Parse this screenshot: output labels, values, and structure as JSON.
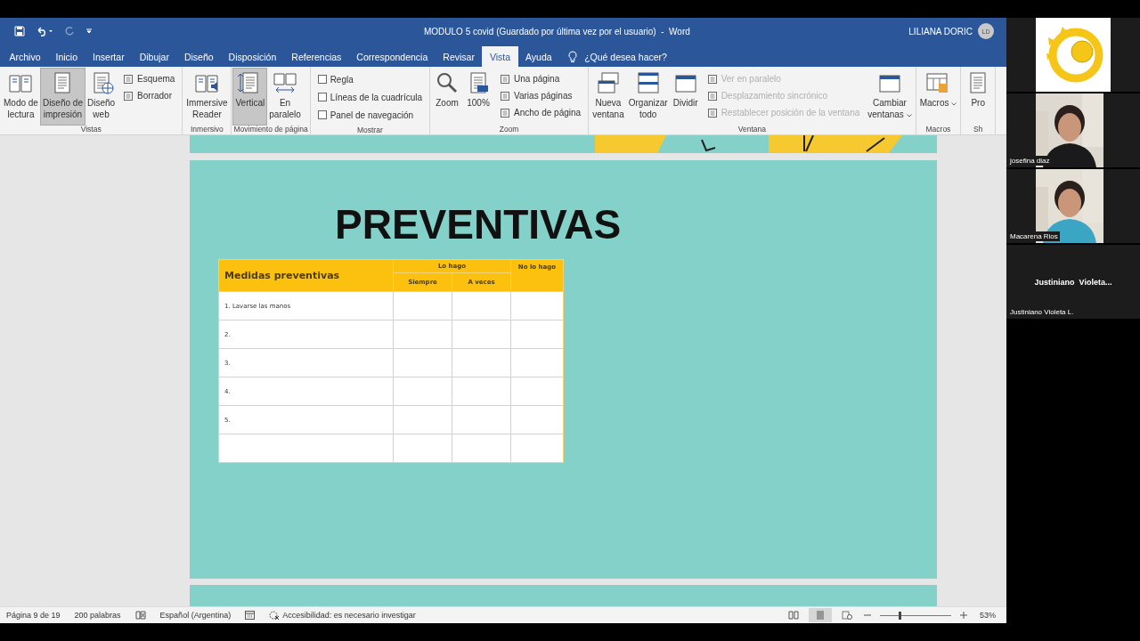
{
  "window": {
    "title": "MODULO 5 covid (Guardado por última vez por el usuario)  -  Word",
    "user": "LILIANA DORIC",
    "avatar": "LD"
  },
  "tabs": [
    {
      "label": "Archivo",
      "selected": false
    },
    {
      "label": "Inicio",
      "selected": false
    },
    {
      "label": "Insertar",
      "selected": false
    },
    {
      "label": "Dibujar",
      "selected": false
    },
    {
      "label": "Diseño",
      "selected": false
    },
    {
      "label": "Disposición",
      "selected": false
    },
    {
      "label": "Referencias",
      "selected": false
    },
    {
      "label": "Correspondencia",
      "selected": false
    },
    {
      "label": "Revisar",
      "selected": false
    },
    {
      "label": "Vista",
      "selected": true
    },
    {
      "label": "Ayuda",
      "selected": false
    }
  ],
  "tell_me": "¿Qué desea hacer?",
  "ribbon": [
    {
      "label": "Vistas",
      "items": [
        {
          "kind": "large",
          "lines": [
            "Modo de",
            "lectura"
          ],
          "selected": false
        },
        {
          "kind": "large",
          "lines": [
            "Diseño de",
            "impresión"
          ],
          "selected": true
        },
        {
          "kind": "large",
          "lines": [
            "Diseño",
            "web"
          ],
          "selected": false
        },
        {
          "kind": "stack",
          "entries": [
            {
              "kind": "button",
              "label": "Esquema",
              "disabled": false
            },
            {
              "kind": "button",
              "label": "Borrador",
              "disabled": false
            }
          ]
        }
      ]
    },
    {
      "label": "Inmersivo",
      "items": [
        {
          "kind": "large",
          "lines": [
            "Immersive",
            "Reader"
          ],
          "selected": false
        }
      ]
    },
    {
      "label": "Movimiento de página",
      "items": [
        {
          "kind": "large",
          "lines": [
            "Vertical"
          ],
          "selected": true
        },
        {
          "kind": "large",
          "lines": [
            "En",
            "paralelo"
          ],
          "selected": false
        }
      ]
    },
    {
      "label": "Mostrar",
      "items": [
        {
          "kind": "stack",
          "entries": [
            {
              "kind": "check",
              "label": "Regla",
              "checked": false
            },
            {
              "kind": "check",
              "label": "Líneas de la cuadrícula",
              "checked": false
            },
            {
              "kind": "check",
              "label": "Panel de navegación",
              "checked": false
            }
          ]
        }
      ]
    },
    {
      "label": "Zoom",
      "items": [
        {
          "kind": "large",
          "lines": [
            "Zoom"
          ],
          "selected": false
        },
        {
          "kind": "large",
          "lines": [
            "100%"
          ],
          "selected": false
        },
        {
          "kind": "stack",
          "entries": [
            {
              "kind": "button",
              "label": "Una página",
              "disabled": false
            },
            {
              "kind": "button",
              "label": "Varias páginas",
              "disabled": false
            },
            {
              "kind": "button",
              "label": "Ancho de página",
              "disabled": false
            }
          ]
        }
      ]
    },
    {
      "label": "Ventana",
      "items": [
        {
          "kind": "large",
          "lines": [
            "Nueva",
            "ventana"
          ],
          "selected": false
        },
        {
          "kind": "large",
          "lines": [
            "Organizar",
            "todo"
          ],
          "selected": false
        },
        {
          "kind": "large",
          "lines": [
            "Dividir"
          ],
          "selected": false
        },
        {
          "kind": "stack",
          "entries": [
            {
              "kind": "button",
              "label": "Ver en paralelo",
              "disabled": true
            },
            {
              "kind": "button",
              "label": "Desplazamiento sincrónico",
              "disabled": true
            },
            {
              "kind": "button",
              "label": "Restablecer posición de la ventana",
              "disabled": true
            }
          ]
        },
        {
          "kind": "large",
          "lines": [
            "Cambiar",
            "ventanas"
          ],
          "selected": false,
          "dropdown": true
        }
      ]
    },
    {
      "label": "Macros",
      "items": [
        {
          "kind": "large",
          "lines": [
            "Macros"
          ],
          "selected": false,
          "dropdown": true
        }
      ]
    },
    {
      "label": "Sh",
      "items": [
        {
          "kind": "large",
          "lines": [
            "Pro"
          ],
          "selected": false
        }
      ]
    }
  ],
  "document": {
    "heading": "PREVENTIVAS",
    "table": {
      "first_header": "Medidas preventivas",
      "group_header": "Lo hago",
      "sub_headers": [
        "Siempre",
        "A veces"
      ],
      "last_header": "No lo hago",
      "rows": [
        {
          "label": "1. Lavarse las manos"
        },
        {
          "label": "2."
        },
        {
          "label": "3."
        },
        {
          "label": "4."
        },
        {
          "label": "5."
        },
        {}
      ]
    }
  },
  "status_bar": {
    "left": [
      {
        "kind": "text",
        "text": "Página 9 de 19"
      },
      {
        "kind": "text",
        "text": "200 palabras"
      },
      {
        "kind": "proofing"
      },
      {
        "kind": "text",
        "text": "Español (Argentina)"
      },
      {
        "kind": "recorder"
      },
      {
        "kind": "accessibility",
        "text": "Accesibilidad: es necesario investigar"
      }
    ],
    "views": [
      {
        "selected": false
      },
      {
        "selected": true
      },
      {
        "selected": false
      }
    ],
    "zoom": {
      "level": 0.26,
      "reading": "53%"
    }
  },
  "participants": [
    {
      "kind": "logo"
    },
    {
      "kind": "video",
      "name": "josefina diaz"
    },
    {
      "kind": "video",
      "name": "Macarena Rios"
    },
    {
      "kind": "avatar",
      "display": "Justiniano  Violeta...",
      "name": "Justiniano Violeta L."
    }
  ]
}
